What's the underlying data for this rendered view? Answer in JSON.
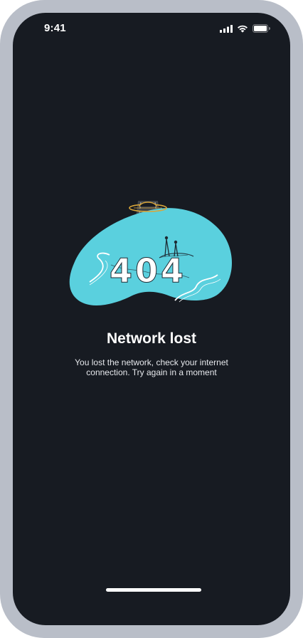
{
  "status_bar": {
    "time": "9:41",
    "icons": [
      "cellular-signal-icon",
      "wifi-icon",
      "battery-icon"
    ]
  },
  "illustration": {
    "icon": "network-lost-404-illustration",
    "text_404": "404",
    "colors": {
      "blob": "#5ad0de",
      "ufo": "#d9a63a",
      "beam": "#ffffff"
    }
  },
  "message": {
    "title": "Network lost",
    "description": "You lost the network, check your internet connection. Try again in a moment"
  },
  "colors": {
    "background": "#171b22",
    "device_frame": "#b9bec8",
    "text": "#ffffff"
  }
}
